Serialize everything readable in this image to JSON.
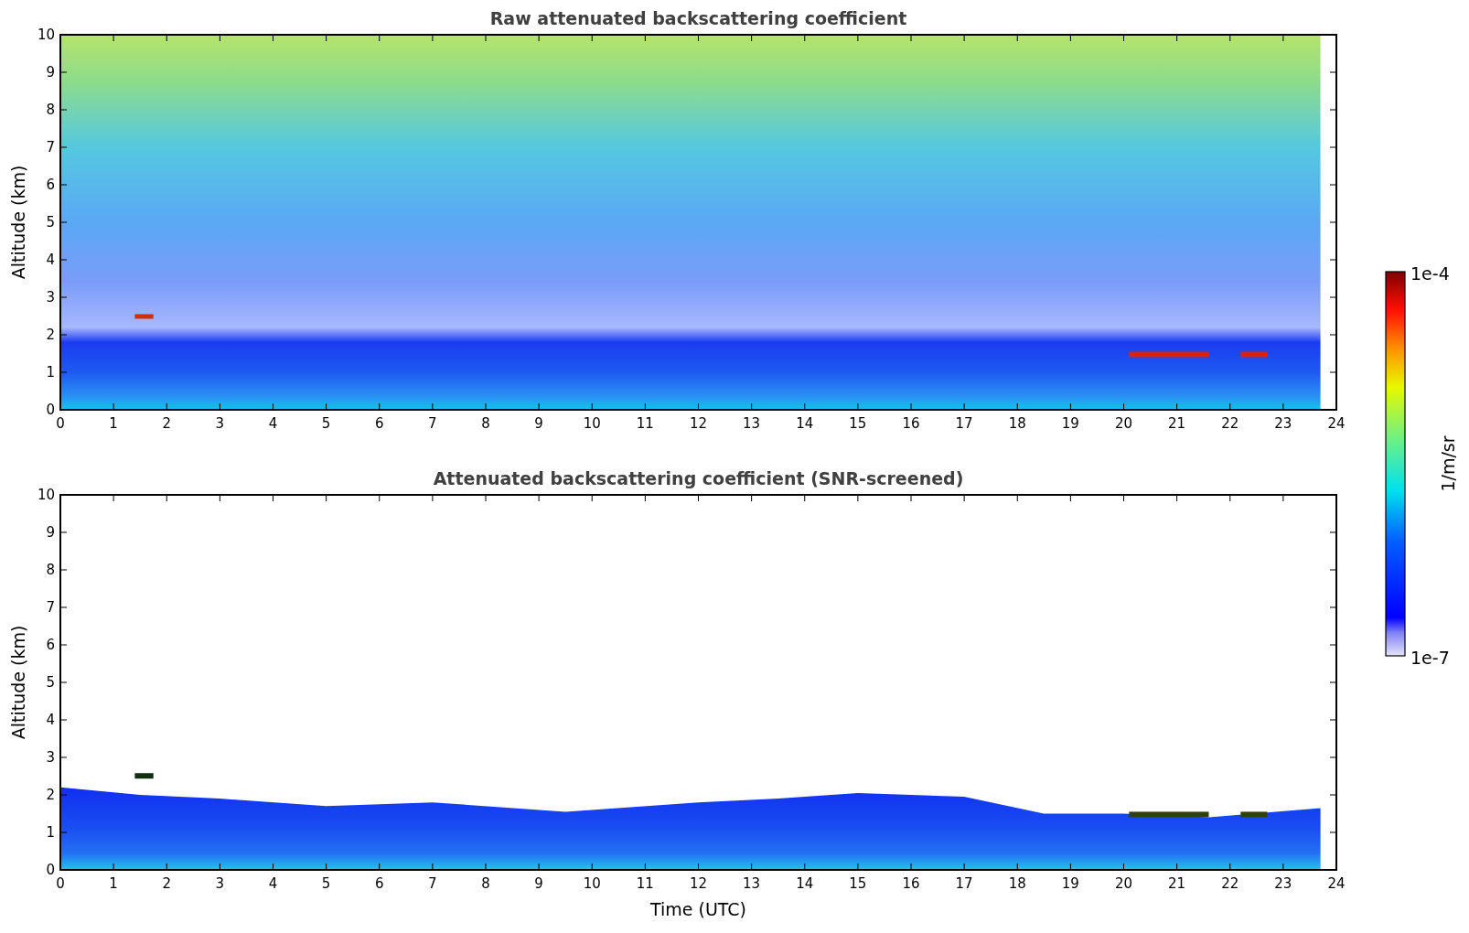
{
  "panels": [
    {
      "title": "Raw attenuated backscattering coefficient",
      "kind": "raw",
      "ylabel": "Altitude (km)",
      "xticks": [
        "0",
        "1",
        "2",
        "3",
        "4",
        "5",
        "6",
        "7",
        "8",
        "9",
        "10",
        "11",
        "12",
        "13",
        "14",
        "15",
        "16",
        "17",
        "18",
        "19",
        "20",
        "21",
        "22",
        "23",
        "24"
      ],
      "yticks": [
        "10",
        "9",
        "8",
        "7",
        "6",
        "5",
        "4",
        "3",
        "2",
        "1",
        "0"
      ]
    },
    {
      "title": "Attenuated backscattering coefficient (SNR-screened)",
      "kind": "screened",
      "ylabel": "Altitude (km)",
      "xlabel": "Time (UTC)",
      "xticks": [
        "0",
        "1",
        "2",
        "3",
        "4",
        "5",
        "6",
        "7",
        "8",
        "9",
        "10",
        "11",
        "12",
        "13",
        "14",
        "15",
        "16",
        "17",
        "18",
        "19",
        "20",
        "21",
        "22",
        "23",
        "24"
      ],
      "yticks": [
        "10",
        "9",
        "8",
        "7",
        "6",
        "5",
        "4",
        "3",
        "2",
        "1",
        "0"
      ]
    }
  ],
  "colorbar": {
    "max_label": "1e-4",
    "min_label": "1e-7",
    "label": "1/m/sr"
  }
}
